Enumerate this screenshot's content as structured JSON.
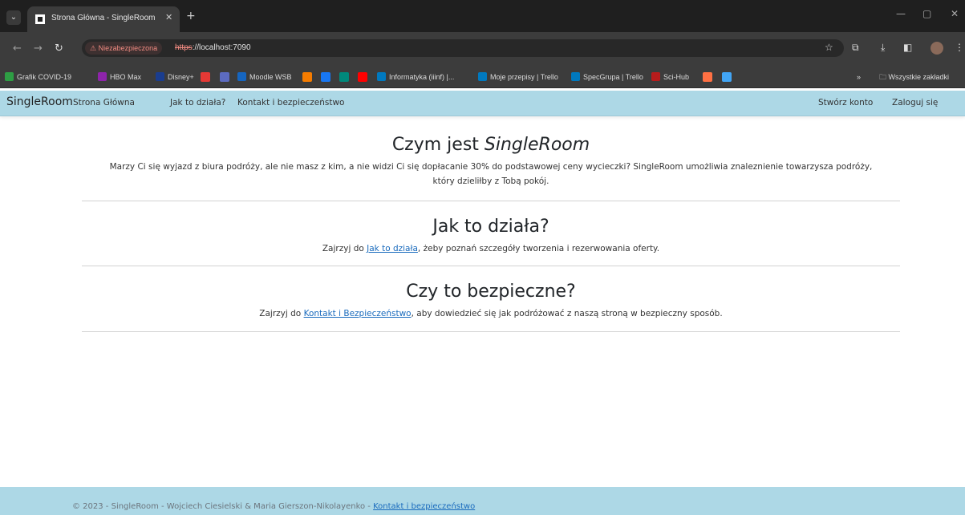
{
  "browser": {
    "tab_title": "Strona Główna - SingleRoom",
    "security_label": "Niezabezpieczona",
    "url_scheme": "https",
    "url_rest": "://localhost:7090",
    "bookmarks": [
      {
        "label": "Grafik COVID-19",
        "color": "#2e9e44"
      },
      {
        "label": "HBO Max",
        "color": "#8e24aa",
        "badge": "m"
      },
      {
        "label": "Disney+",
        "color": "#1a3d8f"
      },
      {
        "label": "Moodle WSB",
        "color": "#1565c0",
        "badge": "m"
      },
      {
        "label": "Informatyka (iiinf) |...",
        "color": "#0079bf"
      },
      {
        "label": "Moje przepisy | Trello",
        "color": "#0079bf"
      },
      {
        "label": "SpecGrupa | Trello",
        "color": "#0079bf"
      },
      {
        "label": "Sci-Hub",
        "color": "#b71c1c"
      }
    ],
    "overflow": "»",
    "all_bookmarks": "Wszystkie zakładki"
  },
  "navbar": {
    "brand": "SingleRoom",
    "links": [
      "Strona Główna",
      "Jak to działa?",
      "Kontakt i bezpieczeństwo"
    ],
    "register": "Stwórz konto",
    "login": "Zaloguj się"
  },
  "sections": {
    "about": {
      "title_prefix": "Czym jest ",
      "title_emph": "SingleRoom",
      "line1": "Marzy Ci się wyjazd z biura podróży, ale nie masz z kim, a nie widzi Ci się dopłacanie 30% do podstawowej ceny wycieczki? SingleRoom umożliwia znaleznienie towarzysza podróży,",
      "line2": "który dzieliłby z Tobą pokój."
    },
    "how": {
      "title": "Jak to działa?",
      "text_before": "Zajrzyj do ",
      "link": "Jak to działa",
      "text_after": ", żeby poznań szczegóły tworzenia i rezerwowania oferty."
    },
    "safe": {
      "title": "Czy to bezpieczne?",
      "text_before": "Zajrzyj do ",
      "link": "Kontakt i Bezpieczeństwo",
      "text_after": ", aby dowiedzieć się jak podróżować z naszą stroną w bezpieczny sposób."
    }
  },
  "footer": {
    "text": "© 2023 - SingleRoom - Wojciech Ciesielski & Maria Gierszon-Nikolayenko - ",
    "link": "Kontakt i bezpieczeństwo"
  },
  "colors": {
    "navbar_bg": "#add8e6",
    "link": "#1a6bbd"
  }
}
